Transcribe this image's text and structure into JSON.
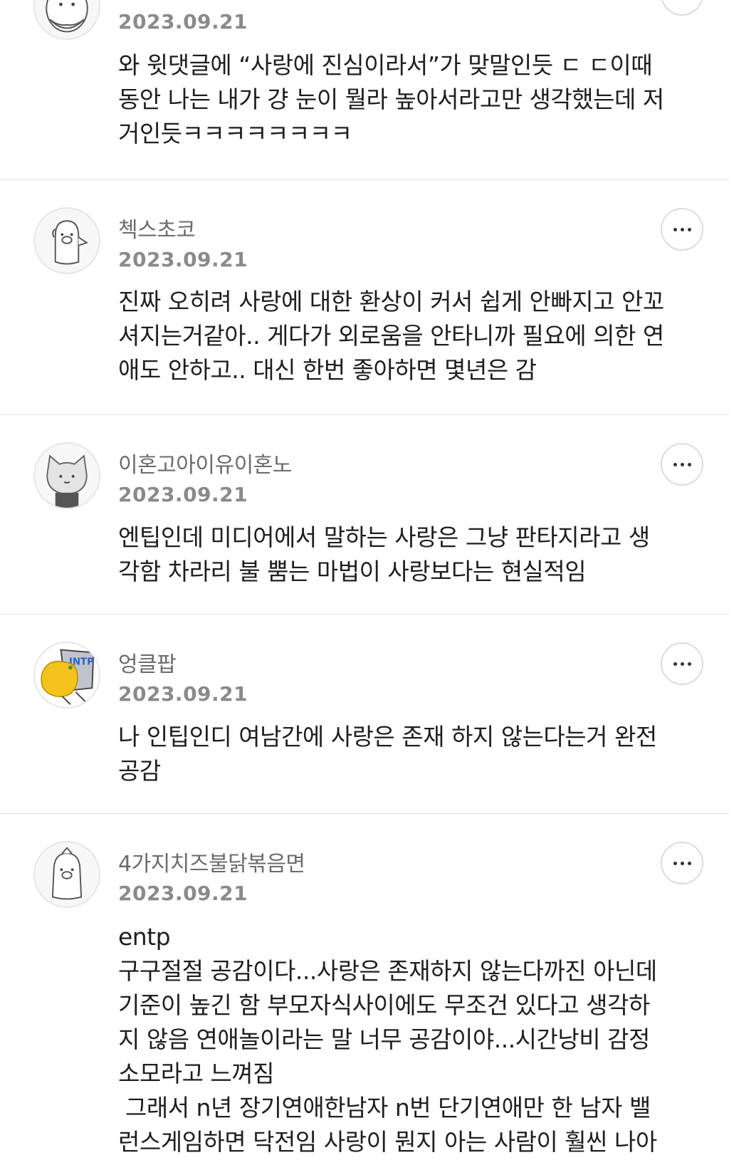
{
  "comments": [
    {
      "nickname": "",
      "date": "2023.09.21",
      "lines": [
        "와 윗댓글에 “사랑에 진심이라서”가 맞말인듯 ㄷ ㄷ이때",
        "동안 나는 내가 걍 눈이 뭘라 높아서라고만 생각했는데 저",
        "거인듯ㅋㅋㅋㅋㅋㅋㅋㅋ"
      ],
      "avatar_icon": "bearded-character-icon"
    },
    {
      "nickname": "첵스초코",
      "date": "2023.09.21",
      "lines": [
        "진짜 오히려 사랑에 대한 환상이 커서 쉽게 안빠지고 안꼬",
        "셔지는거같아.. 게다가 외로움을 안타니까 필요에 의한 연",
        "애도 안하고.. 대신 한번 좋아하면 몇년은 감"
      ],
      "avatar_icon": "pig-character-icon"
    },
    {
      "nickname": "이혼고아이유이혼노",
      "date": "2023.09.21",
      "lines": [
        "엔팁인데 미디어에서 말하는 사랑은 그냥 판타지라고 생",
        "각함 차라리 불 뿜는 마법이 사랑보다는 현실적임"
      ],
      "avatar_icon": "cat-character-icon"
    },
    {
      "nickname": "엉클팝",
      "date": "2023.09.21",
      "lines": [
        "나 인팁인디 여남간에 사랑은 존재 하지 않는다는거 완전",
        "공감"
      ],
      "avatar_icon": "intp-chair-icon"
    },
    {
      "nickname": "4가지치즈불닭볶음면",
      "date": "2023.09.21",
      "lines": [
        "entp",
        "구구절절 공감이다...사랑은 존재하지 않는다까진 아닌데",
        "기준이 높긴 함 부모자식사이에도 무조건 있다고 생각하",
        "지 않음 연애놀이라는 말 너무 공감이야...시간낭비 감정",
        "소모라고 느껴짐",
        " 그래서 n년 장기연애한남자 n번 단기연애만 한 남자 밸",
        "런스게임하면 닥전임 사랑이 뭔지 아는 사람이 훨씬 나아"
      ],
      "avatar_icon": "pig-character-icon"
    }
  ],
  "more_button_label": "more-options"
}
